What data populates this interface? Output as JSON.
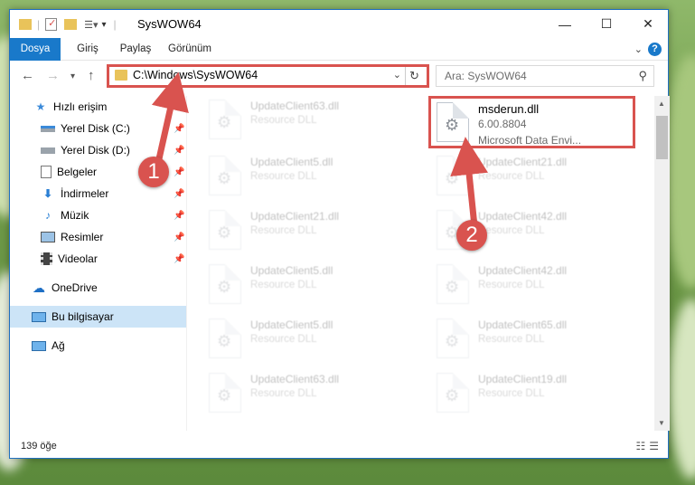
{
  "window": {
    "title": "SysWOW64",
    "min_label": "—",
    "max_label": "☐",
    "close_label": "✕"
  },
  "ribbon": {
    "tabs": [
      "Dosya",
      "Giriş",
      "Paylaş",
      "Görünüm"
    ],
    "help_label": "?"
  },
  "nav": {
    "address": "C:\\Windows\\SysWOW64",
    "search_placeholder": "Ara: SysWOW64"
  },
  "sidebar": {
    "items": [
      {
        "label": "Hızlı erişim",
        "icon": "star-icon"
      },
      {
        "label": "Yerel Disk (C:)",
        "icon": "drive-icon"
      },
      {
        "label": "Yerel Disk (D:)",
        "icon": "drive-icon"
      },
      {
        "label": "Belgeler",
        "icon": "documents-icon"
      },
      {
        "label": "İndirmeler",
        "icon": "download-icon"
      },
      {
        "label": "Müzik",
        "icon": "music-icon"
      },
      {
        "label": "Resimler",
        "icon": "pictures-icon"
      },
      {
        "label": "Videolar",
        "icon": "video-icon"
      },
      {
        "label": "OneDrive",
        "icon": "cloud-icon"
      },
      {
        "label": "Bu bilgisayar",
        "icon": "computer-icon"
      },
      {
        "label": "Ağ",
        "icon": "network-icon"
      }
    ]
  },
  "files": {
    "left": [
      {
        "name": "UpdateClient63.dll",
        "type": "Resource DLL"
      },
      {
        "name": "UpdateClient5.dll",
        "type": "Resource DLL"
      },
      {
        "name": "UpdateClient21.dll",
        "type": "Resource DLL"
      },
      {
        "name": "UpdateClient5.dll",
        "type": "Resource DLL"
      },
      {
        "name": "UpdateClient5.dll",
        "type": "Resource DLL"
      },
      {
        "name": "UpdateClient63.dll",
        "type": "Resource DLL"
      }
    ],
    "right": [
      {
        "name": "msderun.dll",
        "type": "6.00.8804",
        "type2": "Microsoft Data Envi..."
      },
      {
        "name": "UpdateClient21.dll",
        "type": "Resource DLL"
      },
      {
        "name": "UpdateClient42.dll",
        "type": "Resource DLL"
      },
      {
        "name": "UpdateClient42.dll",
        "type": "Resource DLL"
      },
      {
        "name": "UpdateClient65.dll",
        "type": "Resource DLL"
      },
      {
        "name": "UpdateClient19.dll",
        "type": "Resource DLL"
      }
    ]
  },
  "status": {
    "count": "139 öğe"
  },
  "annotations": {
    "badge1": "1",
    "badge2": "2",
    "color": "#d9534f"
  }
}
